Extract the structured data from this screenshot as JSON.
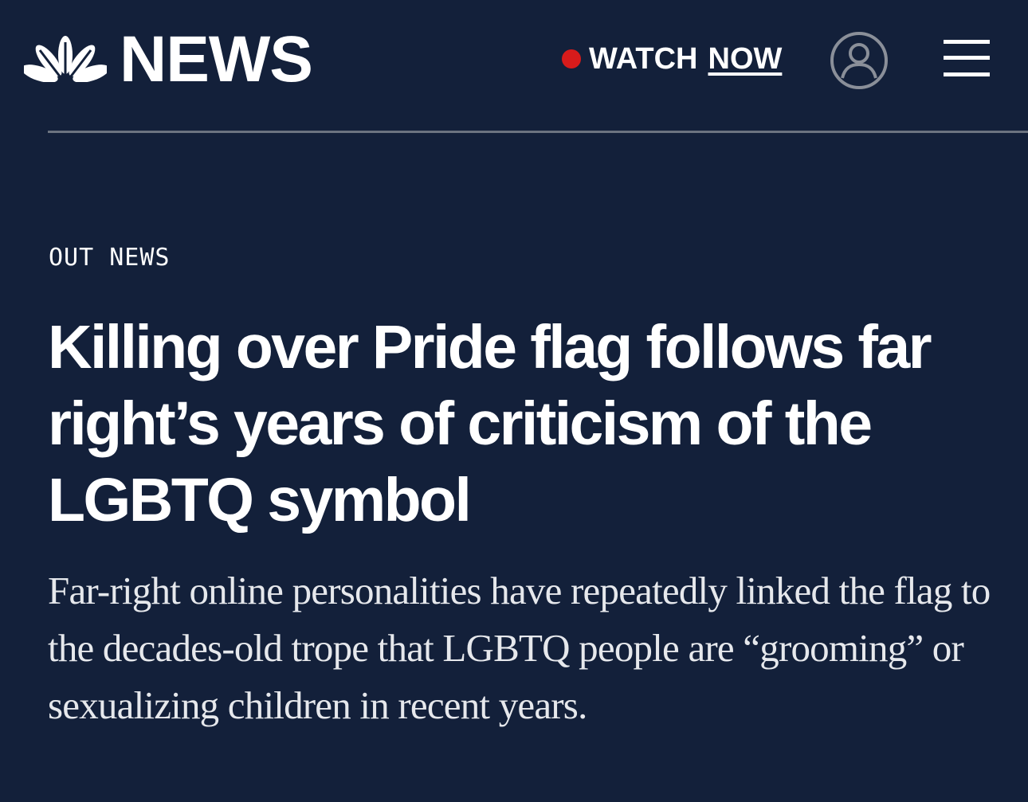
{
  "header": {
    "brand_text": "NEWS",
    "watch_label": "WATCH",
    "watch_emphasis": "NOW",
    "live_dot_color": "#d71b1b",
    "account_icon": "account-circle-icon",
    "menu_icon": "hamburger-menu-icon"
  },
  "article": {
    "section": "OUT NEWS",
    "headline": "Killing over Pride flag follows far right’s years of criticism of the LGBTQ symbol",
    "dek": "Far-right online personalities have repeatedly linked the flag to the decades-old trope that LGBTQ people are “grooming” or sexualizing children in recent years."
  },
  "colors": {
    "background": "#13203a",
    "text": "#ffffff",
    "divider": "#6c7380"
  }
}
